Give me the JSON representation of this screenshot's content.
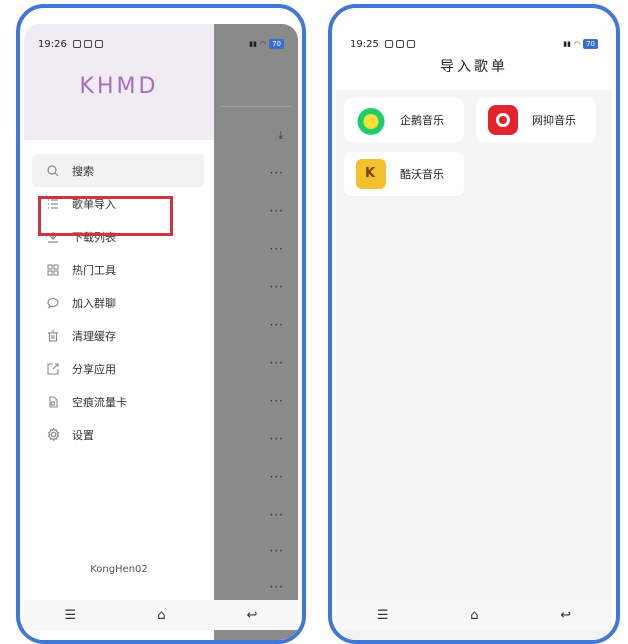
{
  "left_phone": {
    "status": {
      "time": "19:26",
      "battery": "70"
    },
    "brand": "KHMD",
    "menu": [
      {
        "label": "搜索",
        "icon": "search-icon"
      },
      {
        "label": "歌单导入",
        "icon": "list-icon"
      },
      {
        "label": "下载列表",
        "icon": "download-icon"
      },
      {
        "label": "热门工具",
        "icon": "grid-icon"
      },
      {
        "label": "加入群聊",
        "icon": "chat-icon"
      },
      {
        "label": "清理缓存",
        "icon": "trash-icon"
      },
      {
        "label": "分享应用",
        "icon": "share-icon"
      },
      {
        "label": "空痕流量卡",
        "icon": "sim-card-icon"
      },
      {
        "label": "设置",
        "icon": "gear-icon"
      }
    ],
    "username": "KongHen02",
    "overlay_more": "···"
  },
  "right_phone": {
    "status": {
      "time": "19:25",
      "battery": "70"
    },
    "title": "导入歌单",
    "sources": [
      {
        "label": "企鹅音乐",
        "icon": "qq-music-logo"
      },
      {
        "label": "网抑音乐",
        "icon": "netease-music-logo"
      },
      {
        "label": "酷沃音乐",
        "icon": "kuwo-music-logo"
      }
    ]
  },
  "nav": {
    "menu": "☰",
    "home": "⌂",
    "back": "↩"
  },
  "colors": {
    "frame": "#3f78d6",
    "brand": "#a56fbd",
    "highlight": "#cf343f"
  }
}
